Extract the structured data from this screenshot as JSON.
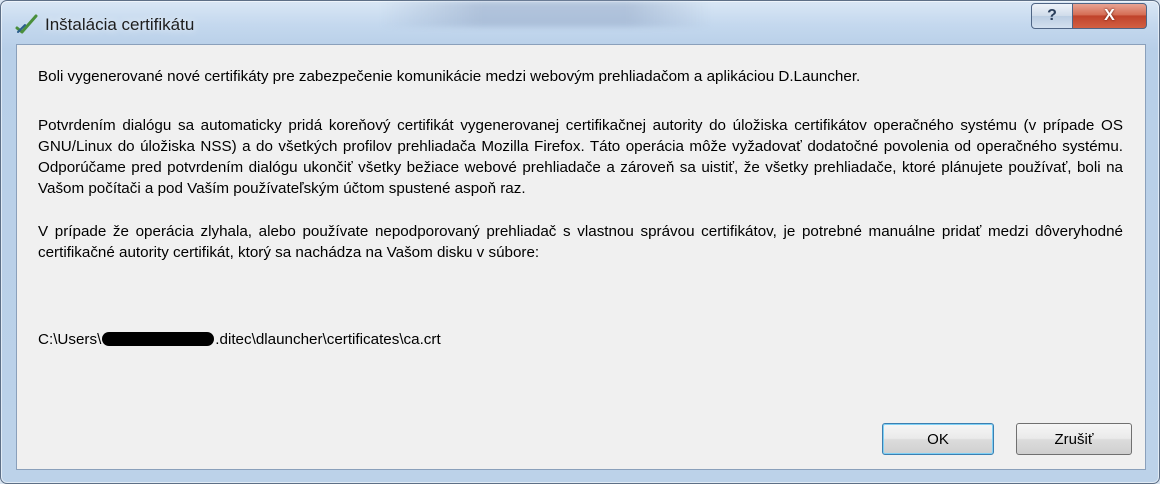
{
  "window": {
    "title": "Inštalácia certifikátu",
    "help_glyph": "?",
    "close_glyph": "X"
  },
  "message": {
    "paragraph1": "Boli vygenerované nové certifikáty pre zabezpečenie komunikácie medzi webovým prehliadačom a aplikáciou D.Launcher.",
    "paragraph2": "Potvrdením dialógu sa automaticky pridá koreňový certifikát vygenerovanej certifikačnej autority do úložiska certifikátov operačného systému (v prípade OS GNU/Linux do úložiska NSS) a do všetkých profilov prehliadača Mozilla Firefox. Táto operácia môže vyžadovať dodatočné povolenia od operačného systému. Odporúčame pred potvrdením dialógu ukončiť všetky bežiace webové prehliadače a zároveň sa uistiť, že všetky prehliadače, ktoré plánujete používať, boli na Vašom počítači a pod Vaším používateľským účtom spustené aspoň raz.",
    "paragraph3": "V prípade že operácia zlyhala, alebo používate nepodporovaný prehliadač s vlastnou správou certifikátov, je potrebné manuálne pridať medzi dôveryhodné certifikačné autority certifikát, ktorý sa nachádza na Vašom disku v súbore:",
    "path_prefix": "C:\\Users\\",
    "path_suffix": ".ditec\\dlauncher\\certificates\\ca.crt"
  },
  "buttons": {
    "ok": "OK",
    "cancel": "Zrušiť"
  },
  "icons": {
    "app": "certificate-check-icon",
    "help": "help-icon",
    "close": "close-icon"
  }
}
